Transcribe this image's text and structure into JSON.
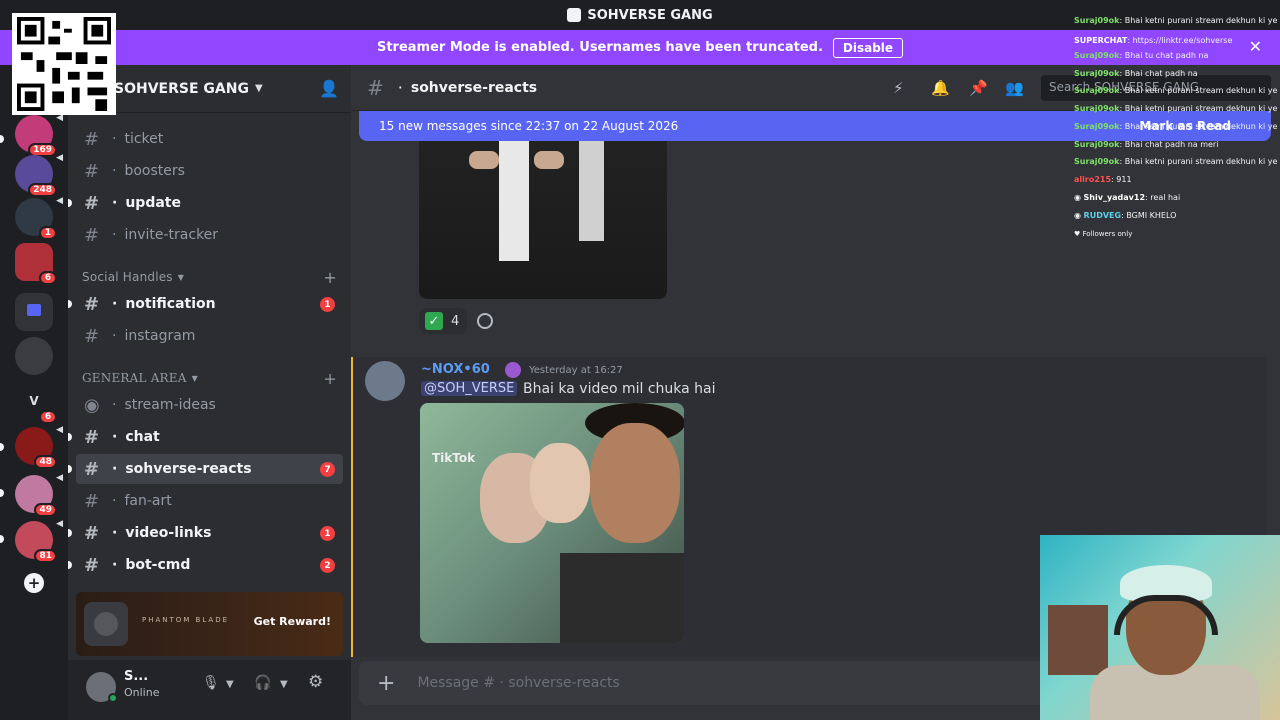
{
  "window": {
    "title": "SOHVERSE GANG"
  },
  "banner": {
    "message": "Streamer Mode is enabled. Usernames have been truncated.",
    "button": "Disable"
  },
  "servers": [
    {
      "badge": "169"
    },
    {
      "badge": "248"
    },
    {
      "badge": "1"
    },
    {
      "badge": "6"
    },
    {
      "badge": ""
    },
    {
      "badge": ""
    },
    {
      "letter": "V",
      "badge": "6"
    },
    {
      "badge": "48"
    },
    {
      "badge": "49"
    },
    {
      "badge": "81"
    }
  ],
  "guild": {
    "name": "SOHVERSE GANG"
  },
  "channels_top": [
    {
      "name": "ticket",
      "unread": false
    },
    {
      "name": "boosters",
      "unread": false
    },
    {
      "name": "update",
      "unread": true
    },
    {
      "name": "invite-tracker",
      "unread": false
    }
  ],
  "category_social": "Social Handles",
  "channels_social": [
    {
      "name": "notification",
      "unread": true,
      "badge": "1"
    },
    {
      "name": "instagram",
      "unread": false
    }
  ],
  "category_general": "GENERAL AREA",
  "channels_general": [
    {
      "name": "stream-ideas",
      "unread": false
    },
    {
      "name": "chat",
      "unread": true
    },
    {
      "name": "sohverse-reacts",
      "unread": true,
      "active": true,
      "badge": "7"
    },
    {
      "name": "fan-art",
      "unread": false
    },
    {
      "name": "video-links",
      "unread": true,
      "badge": "1"
    },
    {
      "name": "bot-cmd",
      "unread": true,
      "badge": "2"
    }
  ],
  "reward": {
    "brand": "PHANTOM BLADE",
    "button": "Get Reward!"
  },
  "user": {
    "name": "S...",
    "status": "Online"
  },
  "channel_header": {
    "name": "sohverse-reacts",
    "search_placeholder": "Search SOHVERSE GANG"
  },
  "new_messages": {
    "text": "15 new messages since 22:37 on 22 August 2026",
    "action": "Mark as Read"
  },
  "message1": {
    "reaction_count": "4"
  },
  "message2": {
    "author": "~NOX•60",
    "timestamp": "Yesterday at 16:27",
    "mention": "@SOH_VERSE",
    "text": "Bhai ka video mil chuka hai",
    "video_watermark": "TikTok"
  },
  "composer": {
    "placeholder": "Message # · sohverse-reacts"
  },
  "overlay_chat": [
    {
      "user": "Suraj09ok",
      "text": "Bhai ketni purani stream dekhun ki ye kaand",
      "color": "g"
    },
    {
      "user": "SUPERCHAT",
      "text": "https://linktr.ee/sohverse",
      "color": "w"
    },
    {
      "user": "Suraj09ok",
      "text": "Bhai tu chat padh na",
      "color": "g"
    },
    {
      "user": "Suraj09ok",
      "text": "Bhai chat padh na",
      "color": "g"
    },
    {
      "user": "Suraj09ok",
      "text": "Bhai ketni purani stream dekhun ki ye kaand",
      "color": "g"
    },
    {
      "user": "Suraj09ok",
      "text": "Bhai ketni purani stream dekhun ki ye kaand",
      "color": "g"
    },
    {
      "user": "Suraj09ok",
      "text": "Bhai ketni purani stream dekhun ki ye kaand",
      "color": "g"
    },
    {
      "user": "Suraj09ok",
      "text": "Bhai chat padh na meri",
      "color": "g"
    },
    {
      "user": "Suraj09ok",
      "text": "Bhai ketni purani stream dekhun ki ye kaand",
      "color": "g"
    },
    {
      "user": "aliro215",
      "text": "911",
      "color": "r"
    },
    {
      "user": "Shiv_yadav12",
      "text": "real hai",
      "color": "w"
    },
    {
      "user": "RUDVEG",
      "text": "BGMI KHELO",
      "color": "c"
    }
  ],
  "overlay_footer": "Followers only"
}
